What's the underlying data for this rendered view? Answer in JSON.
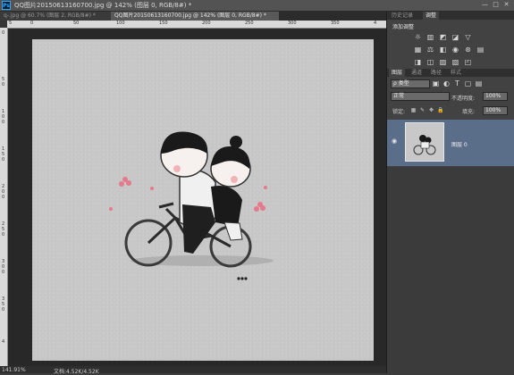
{
  "window": {
    "app_icon_label": "Ps",
    "title": "QQ图片20150613160700.jpg @ 142% (图层 0, RGB/8#) *",
    "controls": [
      "—",
      "□",
      "✕"
    ]
  },
  "tabs": [
    {
      "label": "q-.jpg @ 60.7% (图层 2, RGB/8#) *"
    },
    {
      "label": "QQ图片20150613160700.jpg @ 142% (图层 0, RGB/8#) *"
    }
  ],
  "ruler": {
    "top_numbers": [
      "5",
      "0",
      "50",
      "100",
      "150",
      "200",
      "250",
      "300",
      "350",
      "4"
    ],
    "left_numbers": [
      "0",
      "5",
      "0",
      "1",
      "0",
      "0",
      "1",
      "5",
      "0",
      "2",
      "0",
      "0",
      "2",
      "5",
      "0",
      "3",
      "0",
      "0",
      "3",
      "5",
      "0",
      "4"
    ]
  },
  "status": {
    "zoom": "141.91%",
    "doc": "文档:4.52K/4.52K"
  },
  "panel": {
    "top_tabs": [
      "历史记录",
      "调整"
    ],
    "adjust_label": "添加调整",
    "adjust_icons_row1": [
      "sun-icon",
      "levels-icon",
      "curves-icon",
      "exposure-icon",
      "triangle-down-icon"
    ],
    "adjust_icons_row2": [
      "vibrance-icon",
      "balance-icon",
      "bw-icon",
      "photo-filter-icon",
      "mixer-icon",
      "grid-lookup-icon"
    ],
    "adjust_icons_row3": [
      "invert-icon",
      "posterize-icon",
      "threshold-icon",
      "gradient-map-icon",
      "selective-color-icon"
    ],
    "layer_tabs": [
      "图层",
      "通道",
      "路径",
      "样式"
    ],
    "filter_kind": "ρ 类型",
    "blend_mode": "正常",
    "opacity_label": "不透明度:",
    "opacity_value": "100%",
    "lock_label": "锁定:",
    "fill_label": "填充:",
    "fill_value": "100%",
    "layer_name": "图层 0"
  },
  "colors": {
    "panel_bg": "#424242",
    "selected_layer": "#5a6e8a",
    "canvas_bg": "#c8c8c8",
    "workspace": "#282828"
  }
}
